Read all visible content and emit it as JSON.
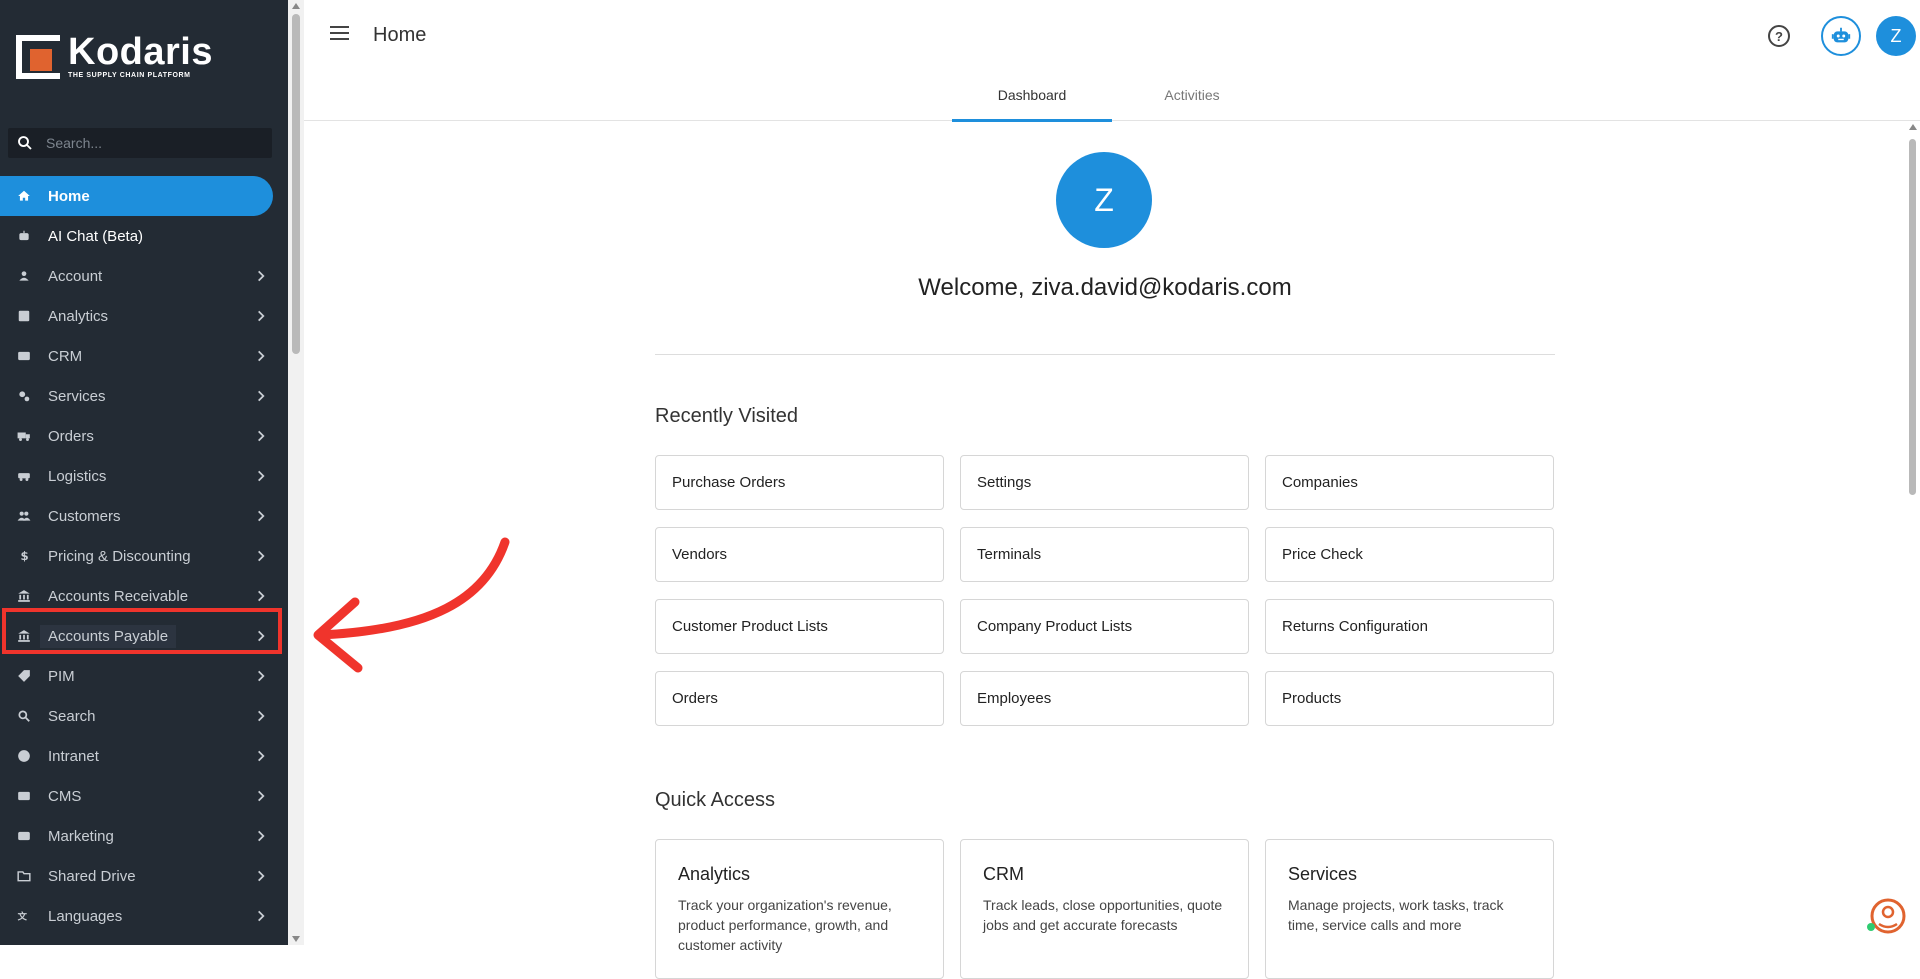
{
  "brand": {
    "name": "Kodaris",
    "tagline": "THE SUPPLY CHAIN PLATFORM",
    "accent": "#1e8fdc",
    "logo_orange": "#e0632f"
  },
  "search": {
    "placeholder": "Search..."
  },
  "nav": [
    {
      "label": "Home",
      "icon": "home-icon",
      "active": true
    },
    {
      "label": "AI Chat (Beta)",
      "icon": "robot-icon"
    },
    {
      "label": "Account",
      "icon": "person-icon",
      "chevron": true
    },
    {
      "label": "Analytics",
      "icon": "chart-icon",
      "chevron": true
    },
    {
      "label": "CRM",
      "icon": "contact-card-icon",
      "chevron": true
    },
    {
      "label": "Services",
      "icon": "gears-icon",
      "chevron": true
    },
    {
      "label": "Orders",
      "icon": "truck-icon",
      "chevron": true
    },
    {
      "label": "Logistics",
      "icon": "van-icon",
      "chevron": true
    },
    {
      "label": "Customers",
      "icon": "people-icon",
      "chevron": true
    },
    {
      "label": "Pricing & Discounting",
      "icon": "dollar-icon",
      "chevron": true
    },
    {
      "label": "Accounts Receivable",
      "icon": "bank-icon",
      "chevron": true
    },
    {
      "label": "Accounts Payable",
      "icon": "bank-icon",
      "chevron": true,
      "highlighted": true
    },
    {
      "label": "PIM",
      "icon": "tag-icon",
      "chevron": true
    },
    {
      "label": "Search",
      "icon": "search-icon",
      "chevron": true
    },
    {
      "label": "Intranet",
      "icon": "globe-icon",
      "chevron": true
    },
    {
      "label": "CMS",
      "icon": "cms-icon",
      "chevron": true
    },
    {
      "label": "Marketing",
      "icon": "marketing-icon",
      "chevron": true
    },
    {
      "label": "Shared Drive",
      "icon": "folder-icon",
      "chevron": true
    },
    {
      "label": "Languages",
      "icon": "translate-icon",
      "chevron": true
    }
  ],
  "header": {
    "title": "Home",
    "avatar_initial": "Z"
  },
  "tabs": [
    {
      "label": "Dashboard",
      "active": true
    },
    {
      "label": "Activities"
    }
  ],
  "welcome": {
    "avatar_initial": "Z",
    "text": "Welcome, ziva.david@kodaris.com"
  },
  "recently_visited": {
    "title": "Recently Visited",
    "items": [
      "Purchase Orders",
      "Settings",
      "Companies",
      "Vendors",
      "Terminals",
      "Price Check",
      "Customer Product Lists",
      "Company Product Lists",
      "Returns Configuration",
      "Orders",
      "Employees",
      "Products"
    ]
  },
  "quick_access": {
    "title": "Quick Access",
    "items": [
      {
        "title": "Analytics",
        "desc": "Track your organization's revenue, product performance, growth, and customer activity"
      },
      {
        "title": "CRM",
        "desc": "Track leads, close opportunities, quote jobs and get accurate forecasts"
      },
      {
        "title": "Services",
        "desc": "Manage projects, work tasks, track time, service calls and more"
      }
    ]
  },
  "annotation_color": "#f0342c"
}
